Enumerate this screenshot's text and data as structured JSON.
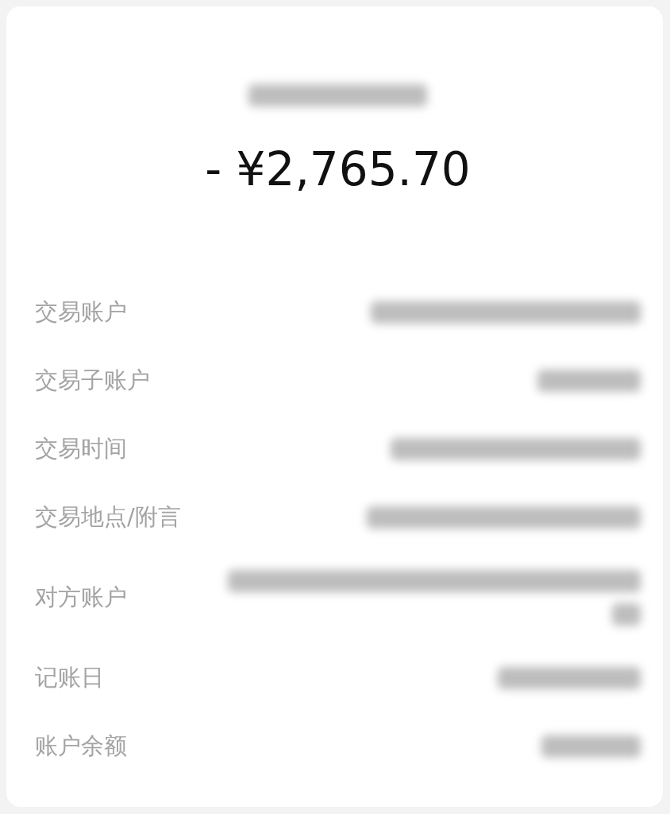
{
  "title": {
    "redacted": true
  },
  "amount": "- ¥2,765.70",
  "rows": [
    {
      "label": "交易账户",
      "redacted": true
    },
    {
      "label": "交易子账户",
      "redacted": true
    },
    {
      "label": "交易时间",
      "redacted": true
    },
    {
      "label": "交易地点/附言",
      "redacted": true
    },
    {
      "label": "对方账户",
      "redacted": true
    },
    {
      "label": "记账日",
      "redacted": true
    },
    {
      "label": "账户余额",
      "redacted": true
    }
  ]
}
